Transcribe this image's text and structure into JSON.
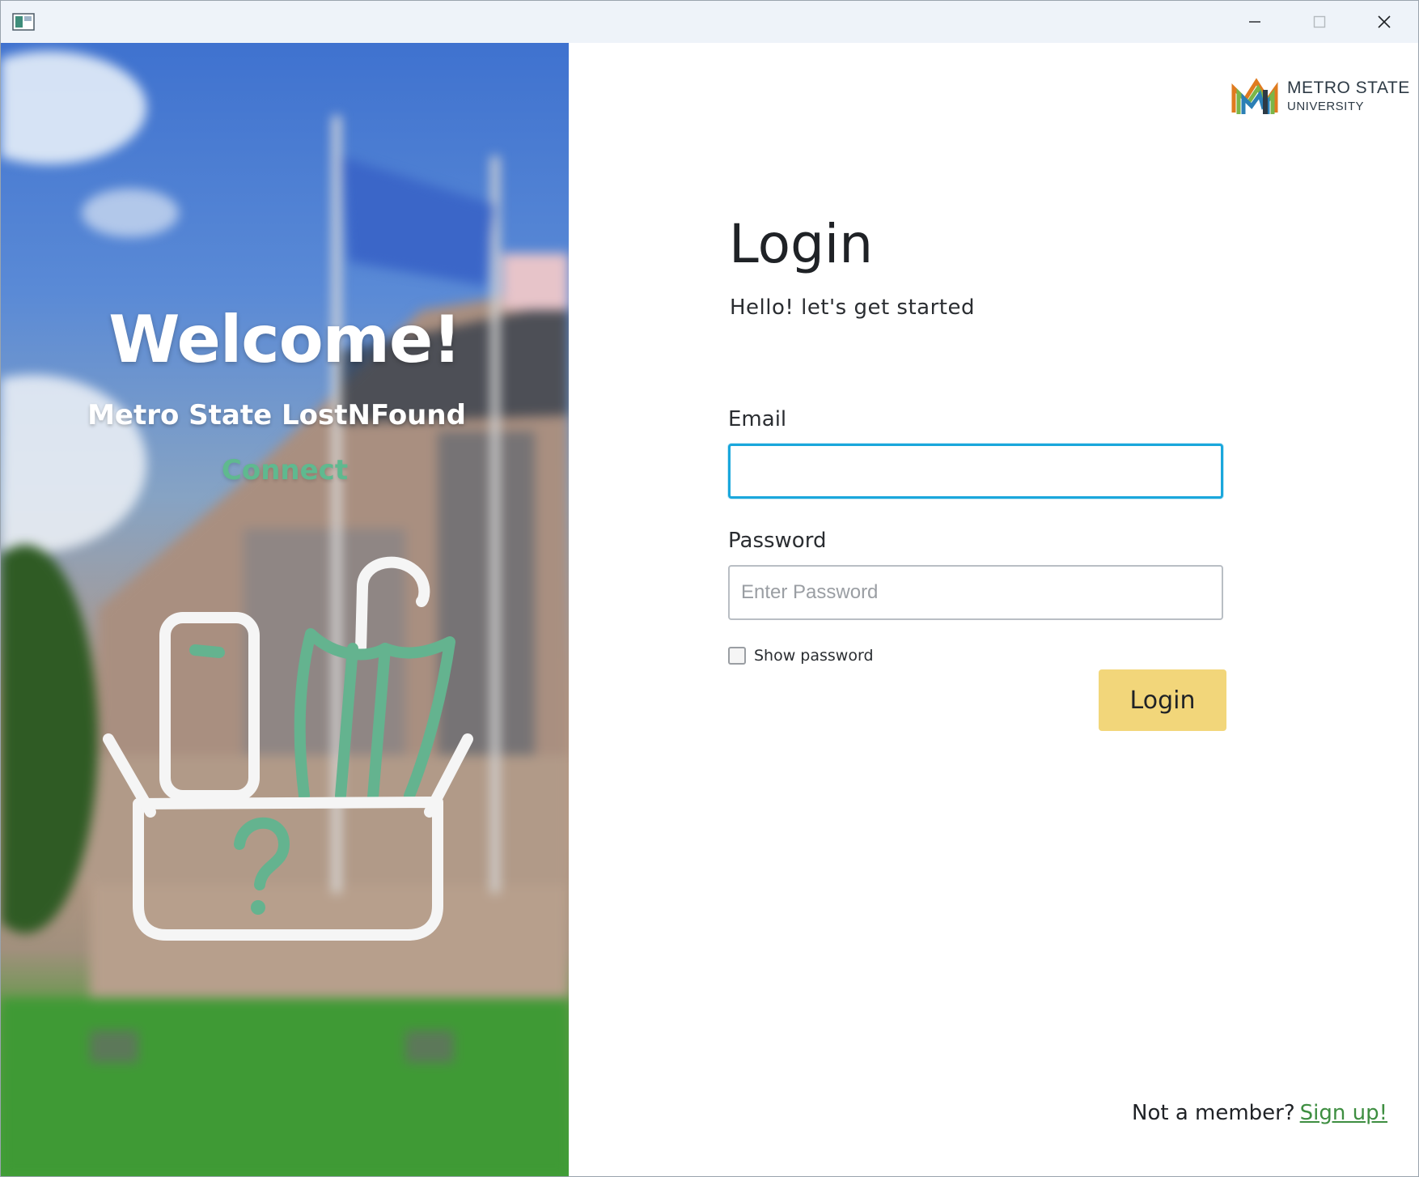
{
  "titlebar": {
    "minimize_icon": "minimize-icon",
    "maximize_icon": "maximize-icon",
    "close_icon": "close-icon"
  },
  "hero": {
    "welcome": "Welcome!",
    "app_name": "Metro State LostNFound",
    "tagline": "Connect",
    "illustration": "lost-and-found-box-icon",
    "tagline_color": "#5fb98f"
  },
  "logo": {
    "line1": "METRO STATE",
    "line2": "UNIVERSITY"
  },
  "form": {
    "title": "Login",
    "subtitle": "Hello! let's get started",
    "email_label": "Email",
    "email_value": "",
    "password_label": "Password",
    "password_placeholder": "Enter Password",
    "show_password_label": "Show password",
    "show_password_checked": false,
    "login_button": "Login",
    "login_button_color": "#f2d67a",
    "focus_color": "#1aa7dc"
  },
  "footer": {
    "prompt": "Not a member?",
    "signup_link": "Sign up!",
    "link_color": "#3e8e41"
  }
}
